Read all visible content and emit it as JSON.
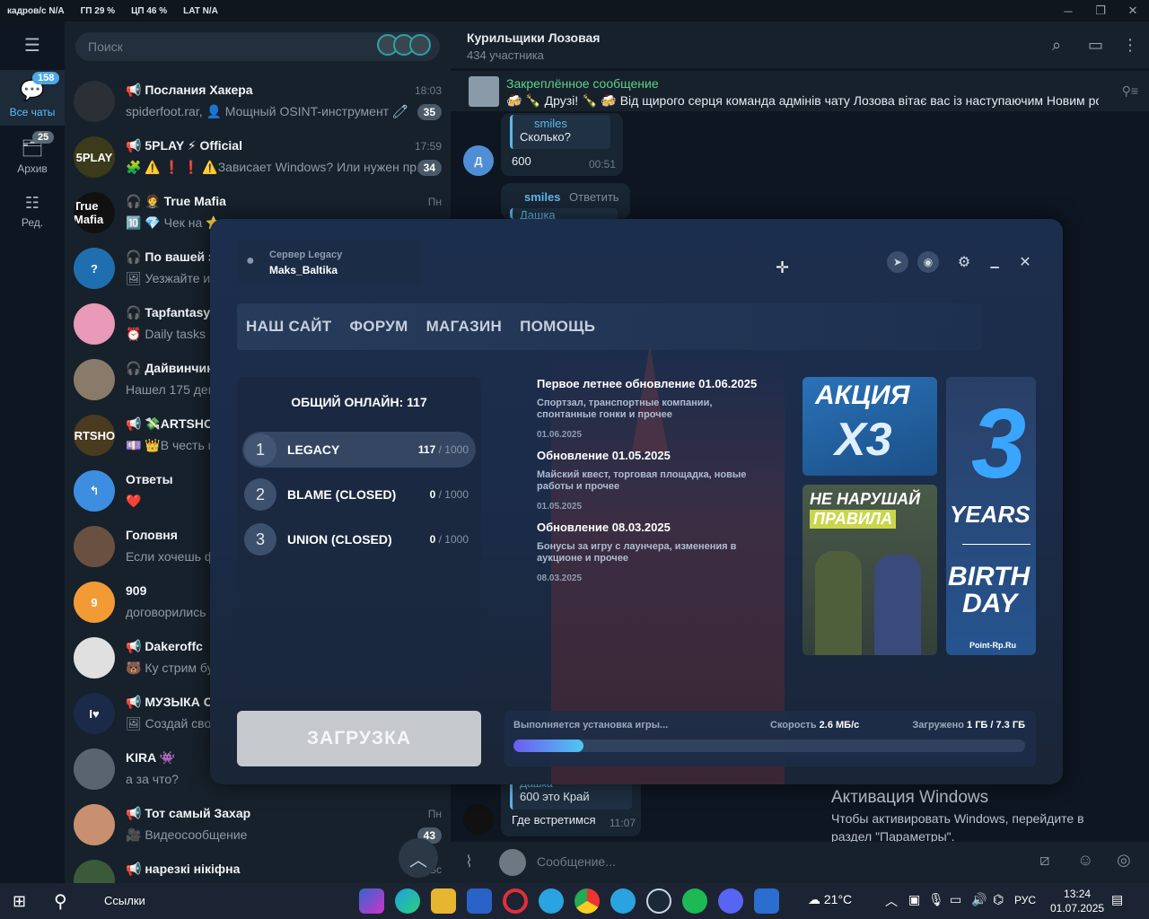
{
  "stats": {
    "fps": "кадров/с  N/A",
    "gpu": "ГП  29 %",
    "cpu": "ЦП  46 %",
    "lat": "LAT  N/A"
  },
  "rail": {
    "all_chats_label": "Все чаты",
    "all_chats_badge": "158",
    "archive_label": "Архив",
    "archive_badge": "25",
    "edit_label": "Ред."
  },
  "search": {
    "placeholder": "Поиск"
  },
  "chats": [
    {
      "name": "📢 Послания Хакера",
      "msg": "spiderfoot.rar, 👤 Мощный OSINT-инструмент 🧷",
      "time": "18:03",
      "count": "35",
      "avatar": "",
      "color": "#2b2f36"
    },
    {
      "name": "📢 5PLAY ⚡ Official",
      "msg": "🧩 ⚠️ ❗ ❗ ⚠️Зависает Windows? Или нужен пр...",
      "time": "17:59",
      "count": "34",
      "avatar": "5PLAY",
      "color": "#3b3a1a"
    },
    {
      "name": "🎧 🤵 True Mafia",
      "msg": "🔟 💎 Чек на ⭐",
      "time": "Пн",
      "count": "",
      "avatar": "True Mafia",
      "color": "#111111"
    },
    {
      "name": "🎧 По вашей з",
      "msg": "🖼 Уезжайте из",
      "time": "",
      "count": "",
      "avatar": "?",
      "color": "#1f6fb0"
    },
    {
      "name": "🎧 Tapfantasy-",
      "msg": "⏰ Daily tasks",
      "time": "",
      "count": "",
      "avatar": "",
      "color": "#e89ab8"
    },
    {
      "name": "🎧 Дайвинчик",
      "msg": "Нашел 175 деву",
      "time": "",
      "count": "",
      "avatar": "",
      "color": "#8a7a6a"
    },
    {
      "name": "📢 💸ARTSHOP",
      "msg": "💷 👑В честь н",
      "time": "",
      "count": "",
      "avatar": "ARTSHOP",
      "color": "#4a3a20"
    },
    {
      "name": "Ответы",
      "msg": "❤️",
      "time": "",
      "count": "",
      "avatar": "↰",
      "color": "#3d8ee0"
    },
    {
      "name": "Головня",
      "msg": "Если хочешь ф",
      "time": "",
      "count": "",
      "avatar": "",
      "color": "#6a5040"
    },
    {
      "name": "909",
      "msg": "договорились",
      "time": "",
      "count": "",
      "avatar": "9",
      "color": "#f29b35"
    },
    {
      "name": "📢 Dakeroffc",
      "msg": "🐻 Ку стрим бу",
      "time": "",
      "count": "",
      "avatar": "",
      "color": "#e0e0e0"
    },
    {
      "name": "📢 МУЗЫКА СЛ",
      "msg": "🖼 Создай свои",
      "time": "",
      "count": "",
      "avatar": "I♥",
      "color": "#1a2a48"
    },
    {
      "name": "KIRA 👾",
      "msg": "а за что?",
      "time": "",
      "count": "",
      "avatar": "",
      "color": "#5a6470"
    },
    {
      "name": "📢 Тот самый Захар",
      "msg": "🎥 Видеосообщение",
      "time": "Пн",
      "count": "43",
      "avatar": "",
      "color": "#c89070"
    },
    {
      "name": "📢 нарезкі нікіфна",
      "msg": "",
      "time": "Вс",
      "count": "",
      "avatar": "",
      "color": "#3a5a3a"
    }
  ],
  "chat": {
    "title": "Курильщики Лозовая",
    "subtitle": "434 участника",
    "pinned_title": "Закреплённое сообщение",
    "pinned_text": "🍻 🍾 Друзі! 🍾 🍻 Від щирого серця команда адмінів чату Лозова вітає вас із наступаючим Новим ро...",
    "msg1_quote_name": "smiles",
    "msg1_quote_text": "Сколько?",
    "msg1_text": "600",
    "msg1_time": "00:51",
    "msg1_avatar": "Д",
    "msg2_name": "smiles",
    "msg2_reply": "Ответить",
    "msg2_quote_name": "Дашка",
    "msg3_quote_name": "Дашка",
    "msg3_quote_text": "600 это Край",
    "msg3_text": "Где встретимся",
    "msg3_time": "11:07",
    "composer_placeholder": "Сообщение..."
  },
  "windows_activation": {
    "title": "Активация Windows",
    "text": "Чтобы активировать Windows, перейдите в раздел \"Параметры\"."
  },
  "launcher": {
    "server_label": "Сервер Legacy",
    "username": "Maks_Baltika",
    "nav": [
      "НАШ САЙТ",
      "ФОРУМ",
      "МАГАЗИН",
      "ПОМОЩЬ"
    ],
    "online_label": "ОБЩИЙ ОНЛАЙН: 117",
    "servers": [
      {
        "num": "1",
        "name": "LEGACY",
        "online": "117",
        "max": "/ 1000"
      },
      {
        "num": "2",
        "name": "BLAME (CLOSED)",
        "online": "0",
        "max": "/ 1000"
      },
      {
        "num": "3",
        "name": "UNION (CLOSED)",
        "online": "0",
        "max": "/ 1000"
      }
    ],
    "news": [
      {
        "title": "Первое летнее обновление 01.06.2025",
        "text": "Спортзал, транспортные компании, спонтанные гонки и прочее",
        "date": "01.06.2025"
      },
      {
        "title": "Обновление 01.05.2025",
        "text": "Майский квест, торговая площадка, новые работы и прочее",
        "date": "01.05.2025"
      },
      {
        "title": "Обновление 08.03.2025",
        "text": "Бонусы за игру с лаунчера, изменения в аукционе и прочее",
        "date": "08.03.2025"
      }
    ],
    "banners": {
      "promo_line1": "АКЦИЯ",
      "promo_line2": "X3",
      "rules_line1": "НЕ НАРУШАЙ",
      "rules_line2": "ПРАВИЛА",
      "bday_num": "3",
      "bday_years": "YEARS",
      "bday_birth": "BIRTH",
      "bday_day": "DAY",
      "bday_site": "Point-Rp.Ru"
    },
    "load_button": "ЗАГРУЗКА",
    "progress": {
      "status": "Выполняется установка игры...",
      "speed_label": "Скорость",
      "speed_value": "2.6 МБ/с",
      "loaded_label": "Загружено",
      "loaded_value": "1 ГБ / 7.3 ГБ",
      "fraction": 0.137
    }
  },
  "taskbar": {
    "links": "Ссылки",
    "weather": "21°C",
    "lang": "РУС",
    "time": "13:24",
    "date": "01.07.2025"
  }
}
